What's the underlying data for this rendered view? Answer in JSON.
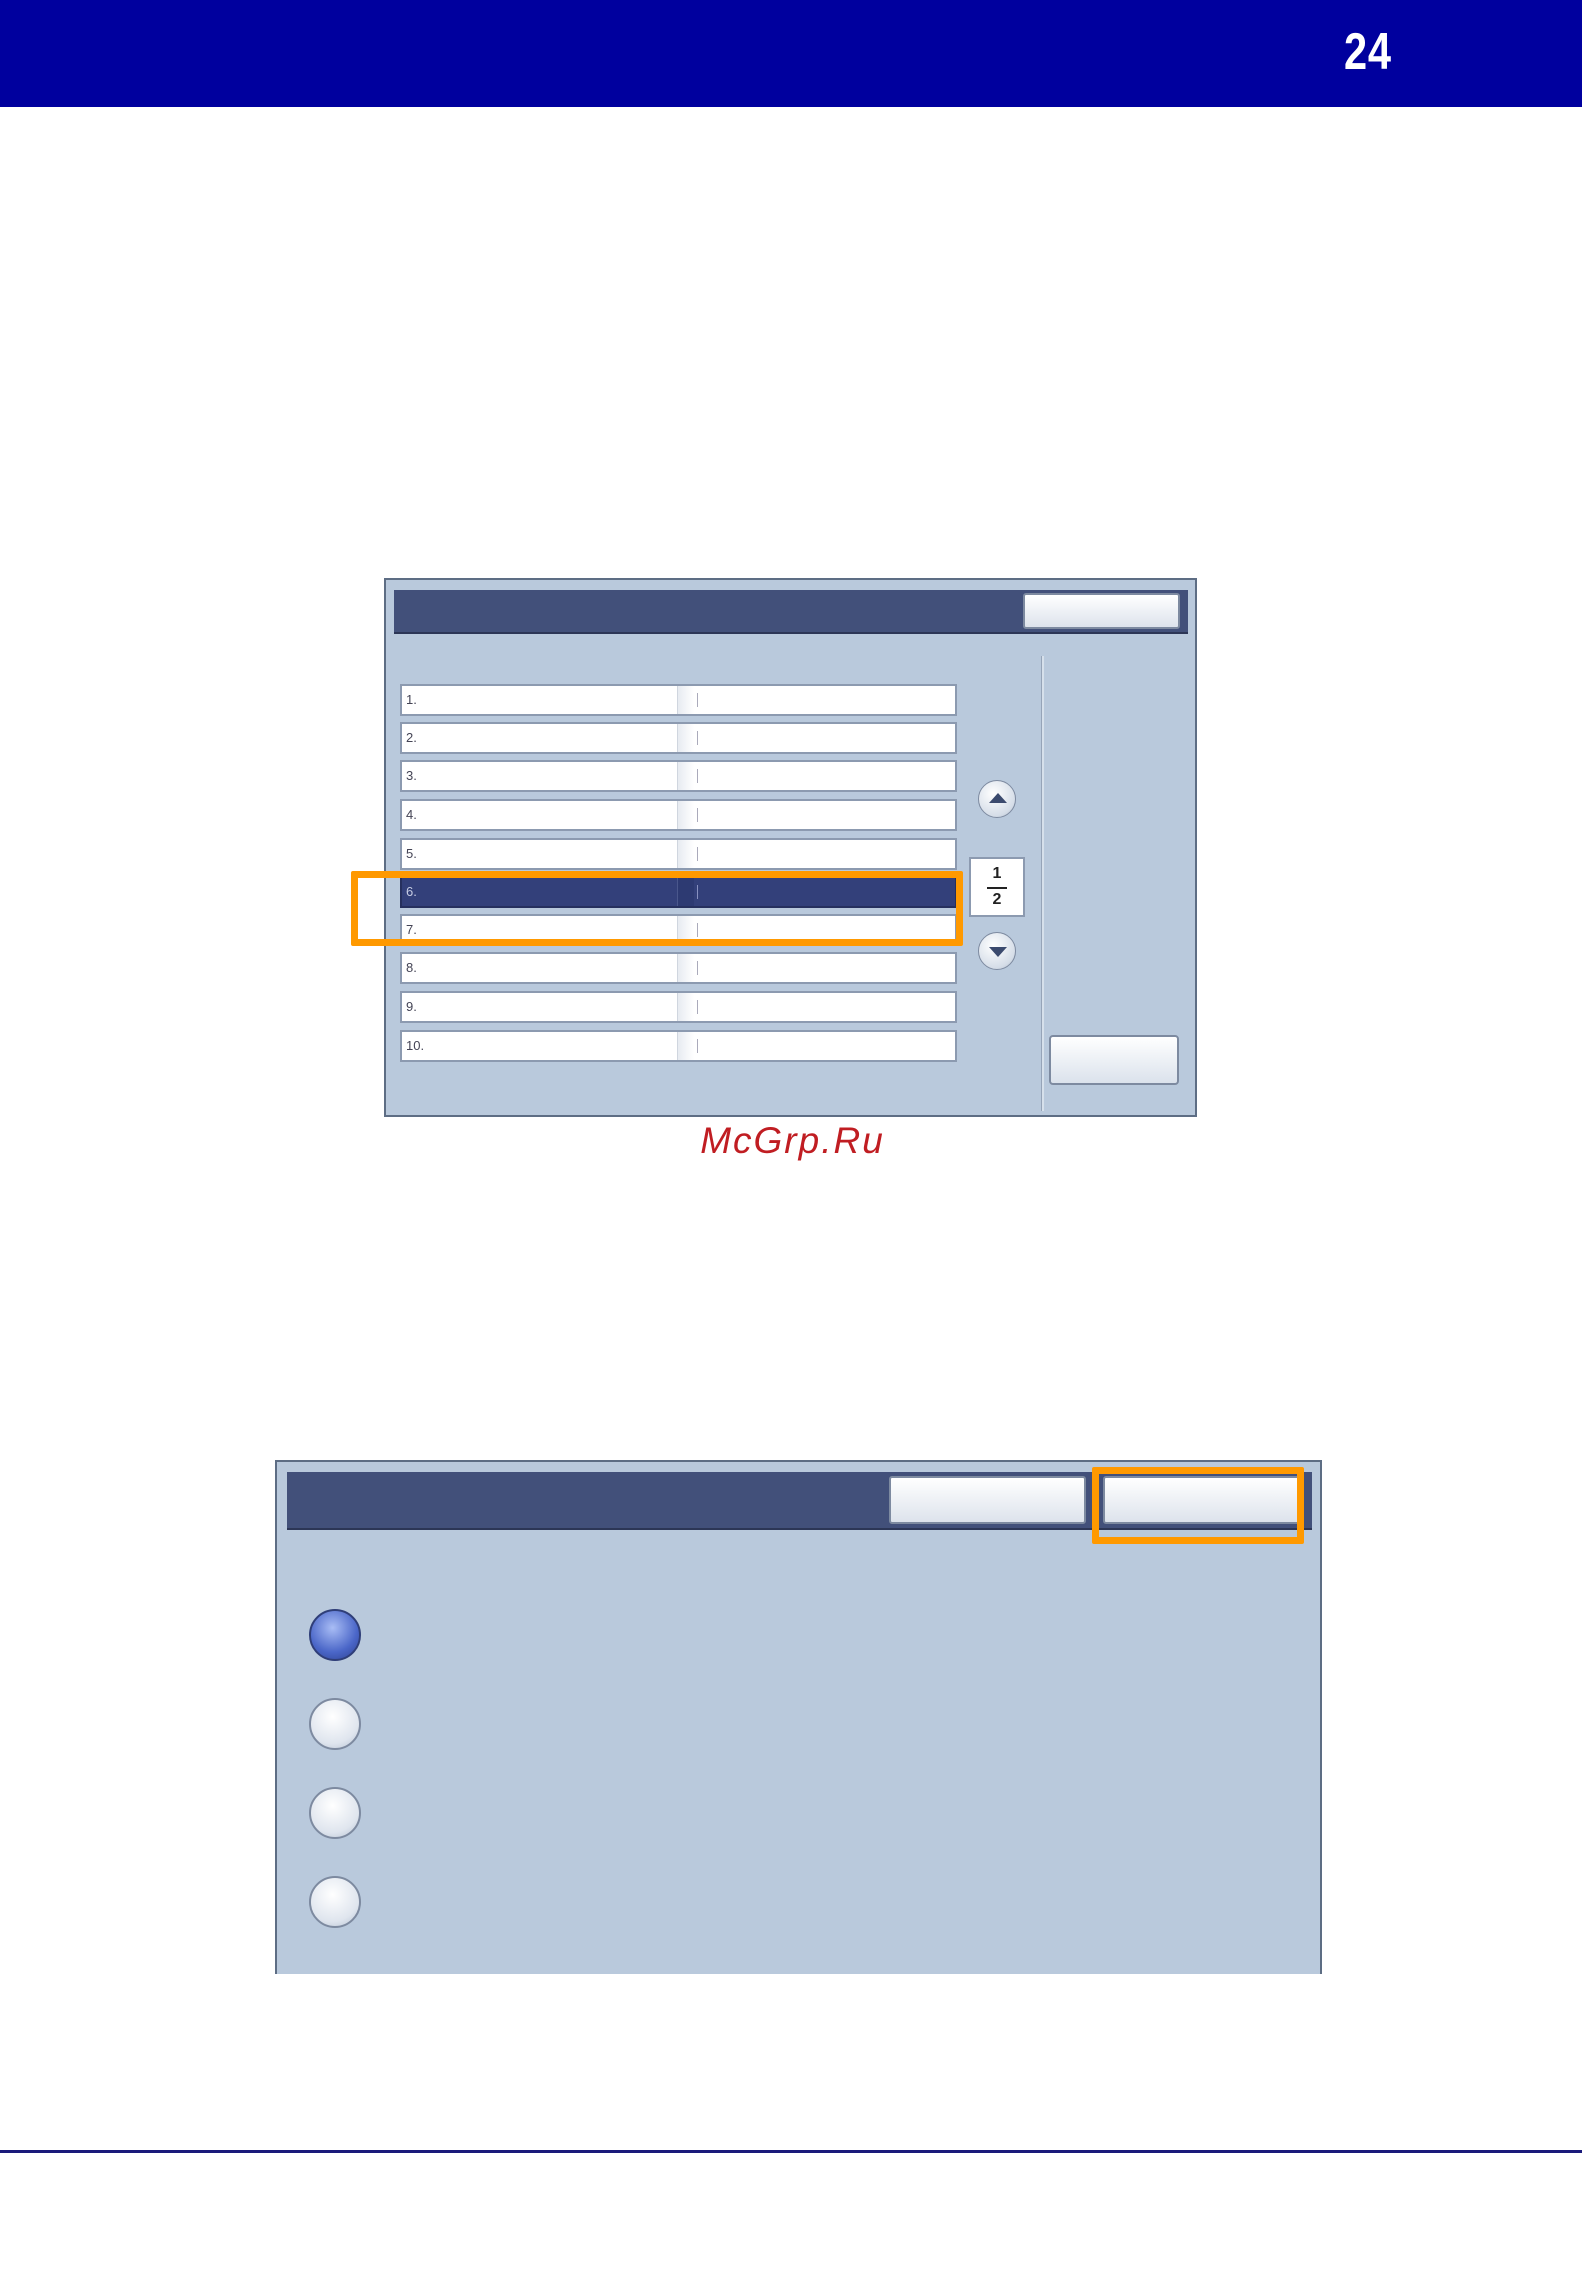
{
  "header": {
    "page_number": "24",
    "band_color": "#00009e"
  },
  "list_screen": {
    "rows": [
      {
        "number": "1.",
        "selected": false
      },
      {
        "number": "2.",
        "selected": false
      },
      {
        "number": "3.",
        "selected": false
      },
      {
        "number": "4.",
        "selected": false
      },
      {
        "number": "5.",
        "selected": false
      },
      {
        "number": "6.",
        "selected": true
      },
      {
        "number": "7.",
        "selected": false
      },
      {
        "number": "8.",
        "selected": false
      },
      {
        "number": "9.",
        "selected": false
      },
      {
        "number": "10.",
        "selected": false
      }
    ],
    "page_indicator": {
      "current": "1",
      "total": "2"
    },
    "icons": [
      "scroll-up-icon",
      "scroll-down-icon"
    ]
  },
  "watermark": "McGrp.Ru",
  "options_screen": {
    "radios": [
      {
        "checked": true
      },
      {
        "checked": false
      },
      {
        "checked": false
      },
      {
        "checked": false
      }
    ]
  },
  "colors": {
    "highlight": "#ff9900",
    "panel_bg": "#b9c9dc",
    "titlebar": "#42507a",
    "selected_row": "#33407a"
  }
}
